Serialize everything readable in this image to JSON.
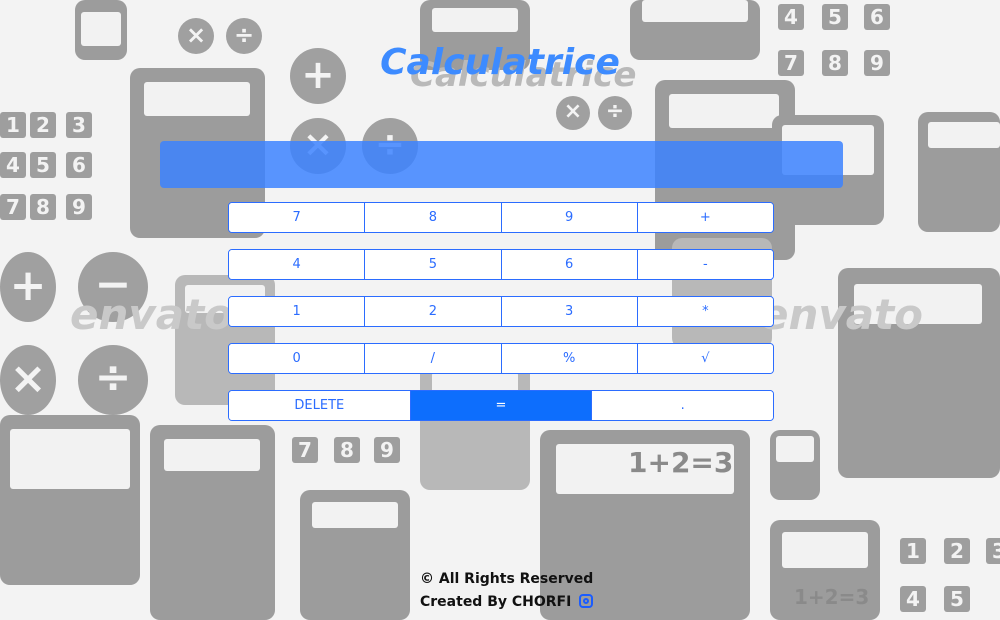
{
  "app": {
    "title": "Calculatrice",
    "display_value": ""
  },
  "keypad": {
    "rows": [
      [
        "7",
        "8",
        "9",
        "+"
      ],
      [
        "4",
        "5",
        "6",
        "-"
      ],
      [
        "1",
        "2",
        "3",
        "*"
      ],
      [
        "0",
        "/",
        "%",
        "√"
      ],
      [
        "DELETE",
        "=",
        "."
      ]
    ]
  },
  "footer": {
    "rights": "© All Rights Reserved",
    "created_by": "Created By CHORFI"
  },
  "background": {
    "watermark_brand": "envato",
    "watermark_title": "Calculatrice",
    "sample_expression": "1+2=3"
  },
  "colors": {
    "accent": "#3d8bff",
    "key_border": "#2b6cff",
    "equals_bg": "#0d6efd"
  }
}
